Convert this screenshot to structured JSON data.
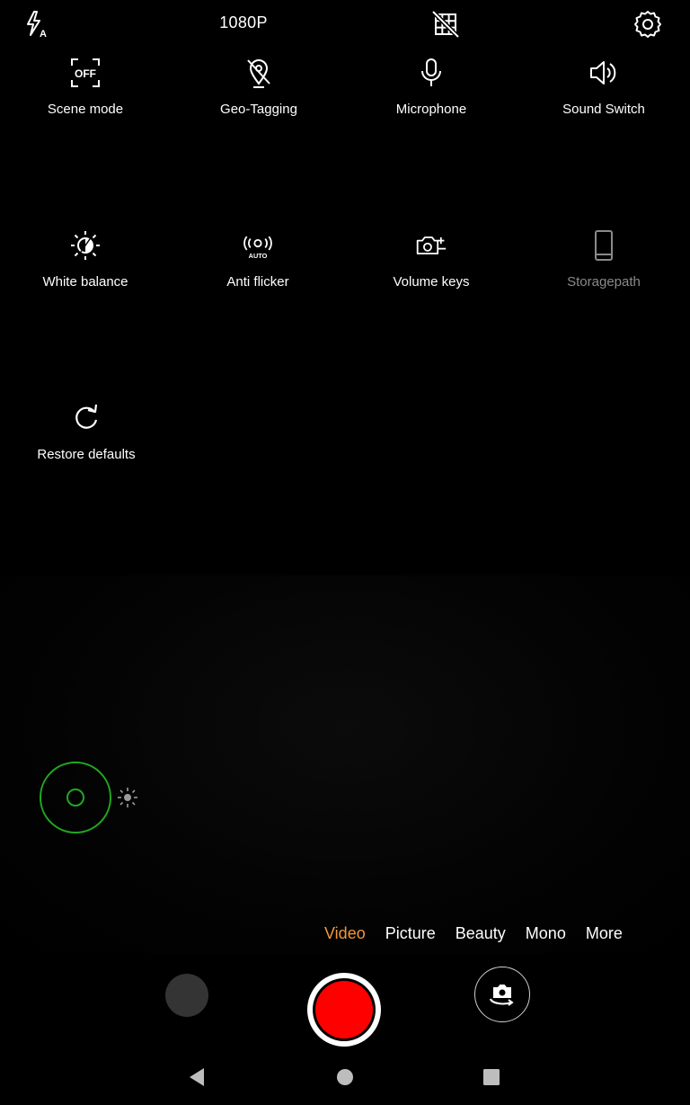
{
  "top_bar": {
    "flash_icon": "flash-auto-icon",
    "resolution": "1080P",
    "grid_icon": "grid-off-icon",
    "settings_icon": "gear-icon"
  },
  "settings": [
    {
      "label": "Scene mode",
      "icon": "scene-off-icon",
      "enabled": true
    },
    {
      "label": "Geo-Tagging",
      "icon": "location-off-icon",
      "enabled": true
    },
    {
      "label": "Microphone",
      "icon": "microphone-icon",
      "enabled": true
    },
    {
      "label": "Sound Switch",
      "icon": "speaker-icon",
      "enabled": true
    },
    {
      "label": "White balance",
      "icon": "white-balance-auto-icon",
      "enabled": true
    },
    {
      "label": "Anti flicker",
      "icon": "anti-flicker-auto-icon",
      "enabled": true,
      "icon_text": "AUTO"
    },
    {
      "label": "Volume keys",
      "icon": "camera-plus-icon",
      "enabled": true
    },
    {
      "label": "Storagepath",
      "icon": "phone-storage-icon",
      "enabled": false
    },
    {
      "label": "Restore defaults",
      "icon": "restore-icon",
      "enabled": true
    }
  ],
  "scene_icon_text": "OFF",
  "focus": {
    "ring_color": "#1fa81f",
    "exposure_icon": "brightness-icon"
  },
  "modes": {
    "active_color": "#f0973a",
    "items": [
      "Video",
      "Picture",
      "Beauty",
      "Mono",
      "More"
    ],
    "active": "Video"
  },
  "controls": {
    "record_color": "#ff0000",
    "gallery_thumb": "gallery-thumbnail",
    "switch_icon": "switch-camera-icon"
  },
  "nav_bar": {
    "back": "back-icon",
    "home": "home-icon",
    "recents": "recents-icon"
  }
}
